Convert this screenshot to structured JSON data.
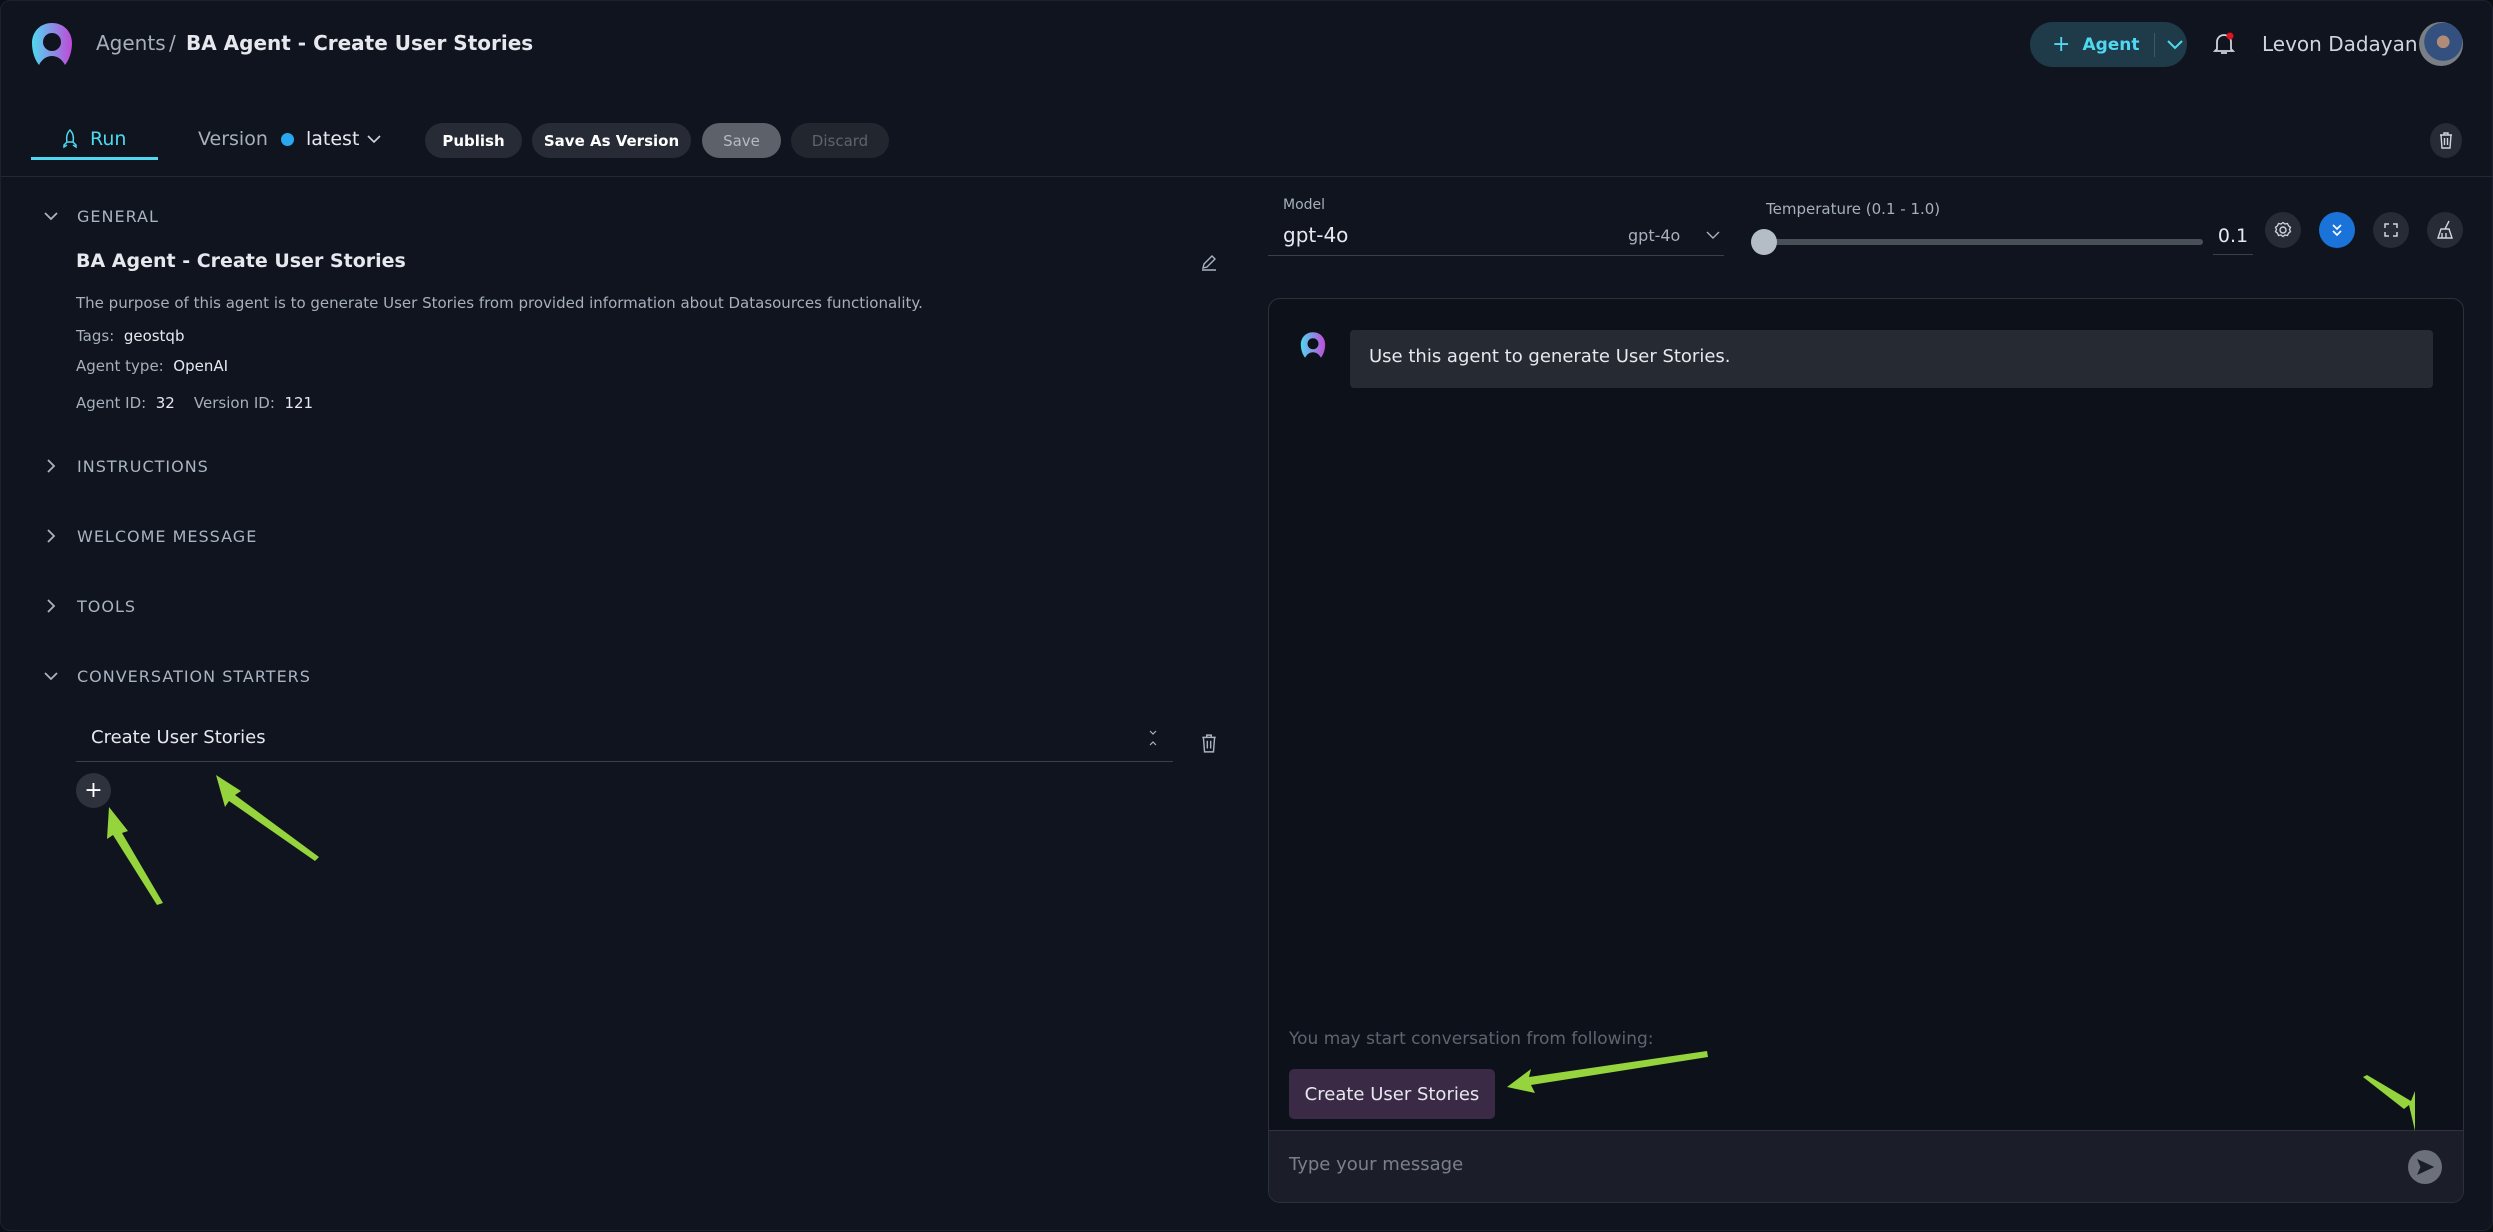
{
  "header": {
    "breadcrumb_root": "Agents",
    "breadcrumb_sep": "/",
    "breadcrumb_current": "BA Agent - Create User Stories",
    "agent_button": "Agent",
    "user_name": "Levon Dadayan",
    "notification_dot": true
  },
  "toolbar": {
    "run_tab": "Run",
    "version_label": "Version",
    "version_value": "latest",
    "publish": "Publish",
    "save_as_version": "Save As Version",
    "save": "Save",
    "discard": "Discard"
  },
  "general": {
    "section": "GENERAL",
    "title": "BA Agent - Create User Stories",
    "description": "The purpose of this agent is to generate User Stories from provided information about Datasources functionality.",
    "tags_label": "Tags:",
    "tags_value": "geostqb",
    "type_label": "Agent type:",
    "type_value": "OpenAI",
    "agent_id_label": "Agent ID:",
    "agent_id": "32",
    "version_id_label": "Version ID:",
    "version_id": "121"
  },
  "sections": {
    "instructions": "INSTRUCTIONS",
    "welcome": "WELCOME MESSAGE",
    "tools": "TOOLS",
    "starters": "CONVERSATION STARTERS"
  },
  "starters": {
    "items": [
      "Create User Stories"
    ]
  },
  "model": {
    "label": "Model",
    "value": "gpt-4o",
    "selected": "gpt-4o"
  },
  "temperature": {
    "label": "Temperature (0.1 - 1.0)",
    "value": "0.1",
    "fraction": 0
  },
  "chat": {
    "welcome": "Use this agent to generate User Stories.",
    "starters_hint": "You may start conversation from following:",
    "starter_chip": "Create User Stories",
    "input_placeholder": "Type your message"
  },
  "colors": {
    "accent": "#4fd8f0",
    "blue": "#1a73d9",
    "annotation_arrow": "#95d43c",
    "chip": "#3a2a45"
  }
}
